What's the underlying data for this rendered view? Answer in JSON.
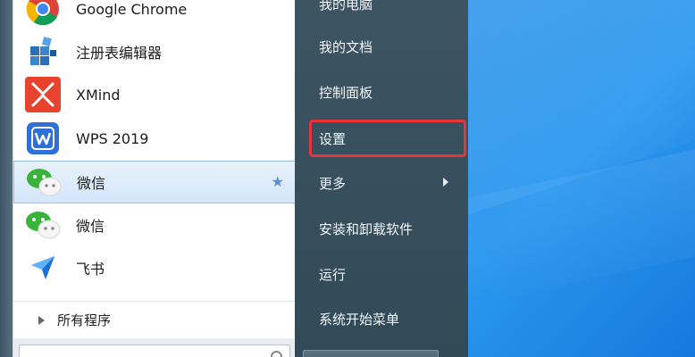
{
  "pinned_apps": [
    {
      "label": "Google Chrome",
      "icon": "chrome-icon"
    },
    {
      "label": "注册表编辑器",
      "icon": "registry-editor-icon"
    },
    {
      "label": "XMind",
      "icon": "xmind-icon"
    },
    {
      "label": "WPS 2019",
      "icon": "wps-icon"
    },
    {
      "label": "微信",
      "icon": "wechat-icon",
      "selected": true
    },
    {
      "label": "微信",
      "icon": "wechat-icon"
    },
    {
      "label": "飞书",
      "icon": "feishu-icon"
    }
  ],
  "all_programs_label": "所有程序",
  "right_menu": [
    {
      "label": "我的电脑"
    },
    {
      "label": "我的文档"
    },
    {
      "label": "控制面板"
    },
    {
      "label": "设置",
      "highlighted": true
    },
    {
      "label": "更多",
      "has_submenu": true
    },
    {
      "label": "安装和卸载软件"
    },
    {
      "label": "运行"
    },
    {
      "label": "系统开始菜单"
    }
  ],
  "colors": {
    "highlight_border": "#e8333a",
    "right_pane_bg": "#3d5563",
    "selected_bg": "#d4e6fb"
  }
}
